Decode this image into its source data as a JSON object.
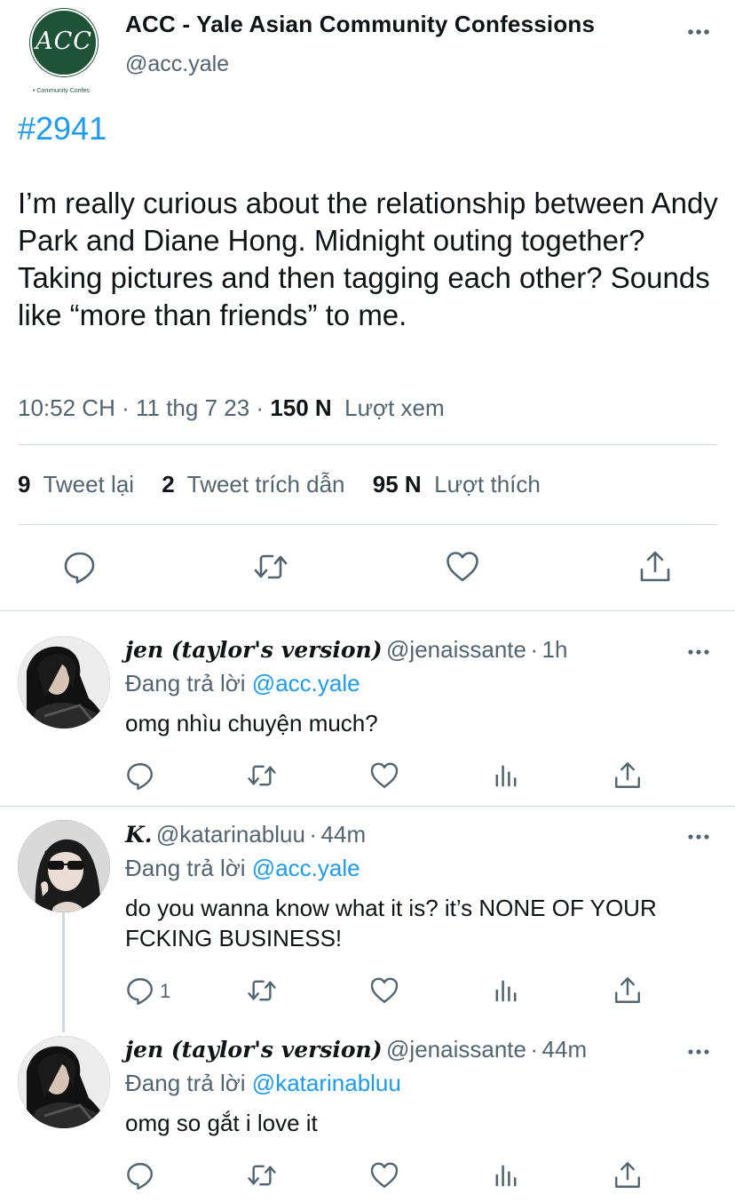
{
  "main_tweet": {
    "avatar_logo": "ACC",
    "avatar_subtext": "• Community Confes",
    "display_name": "ACC - Yale Asian Community Confessions",
    "handle": "@acc.yale",
    "hashtag": "#2941",
    "body": "I’m really curious about the relationship between Andy Park and Diane Hong. Midnight outing together? Taking pictures and then tagging each other? Sounds like “more than friends” to me.",
    "time": "10:52 CH",
    "date": "11 thg 7 23",
    "views_count": "150 N",
    "views_label": "Lượt xem",
    "retweets_count": "9",
    "retweets_label": "Tweet lại",
    "quotes_count": "2",
    "quotes_label": "Tweet trích dẫn",
    "likes_count": "95 N",
    "likes_label": "Lượt thích",
    "separator": "·"
  },
  "replies": [
    {
      "name": "jen (taylor's version)",
      "handle": "@jenaissante",
      "time": "1h",
      "replying_prefix": "Đang trả lời",
      "replying_to": "@acc.yale",
      "text": "omg nhìu chuyện much?",
      "reply_count": ""
    },
    {
      "name": "K.",
      "handle": "@katarinabluu",
      "time": "44m",
      "replying_prefix": "Đang trả lời",
      "replying_to": "@acc.yale",
      "text": "do you wanna know what it is? it’s NONE OF YOUR FCKING BUSINESS!",
      "reply_count": "1"
    },
    {
      "name": "jen (taylor's version)",
      "handle": "@jenaissante",
      "time": "44m",
      "replying_prefix": "Đang trả lời",
      "replying_to": "@katarinabluu",
      "text": "omg so gắt i love it",
      "reply_count": ""
    }
  ],
  "colors": {
    "accent": "#1d9bf0",
    "secondary_text": "#536471",
    "primary_text": "#0f1419",
    "divider": "#cfd9de",
    "logo_green": "#1f5338"
  },
  "icons": [
    "more-icon",
    "reply-icon",
    "retweet-icon",
    "like-icon",
    "share-icon",
    "analytics-icon"
  ]
}
